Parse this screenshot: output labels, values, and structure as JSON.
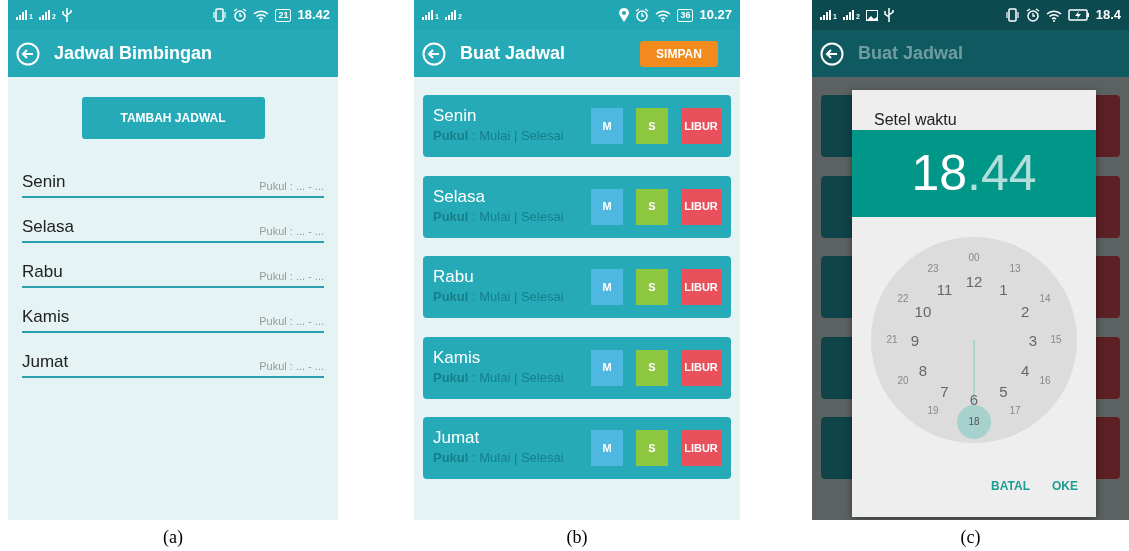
{
  "screens": [
    {
      "kind": "schedule_list",
      "caption": "(a)",
      "status_bar": {
        "sim_labels": [
          "1",
          "2"
        ],
        "battery": "21",
        "time": "18.42"
      },
      "app_bar": {
        "title": "Jadwal Bimbingan"
      },
      "add_button": "TAMBAH JADWAL",
      "days": [
        {
          "name": "Senin",
          "time": "Pukul : ... - ..."
        },
        {
          "name": "Selasa",
          "time": "Pukul : ... - ..."
        },
        {
          "name": "Rabu",
          "time": "Pukul : ... - ..."
        },
        {
          "name": "Kamis",
          "time": "Pukul : ... - ..."
        },
        {
          "name": "Jumat",
          "time": "Pukul : ... - ..."
        }
      ]
    },
    {
      "kind": "create_schedule",
      "caption": "(b)",
      "status_bar": {
        "sim_labels": [
          "1",
          "2"
        ],
        "battery": "36",
        "time": "10.27"
      },
      "app_bar": {
        "title": "Buat Jadwal",
        "action": "SIMPAN"
      },
      "days": [
        {
          "name": "Senin",
          "time": "**Pukul** : Mulai | Selesai",
          "buttons": [
            "M",
            "S",
            "LIBUR"
          ]
        },
        {
          "name": "Selasa",
          "time": "**Pukul** : Mulai | Selesai",
          "buttons": [
            "M",
            "S",
            "LIBUR"
          ]
        },
        {
          "name": "Rabu",
          "time": "**Pukul** : Mulai | Selesai",
          "buttons": [
            "M",
            "S",
            "LIBUR"
          ]
        },
        {
          "name": "Kamis",
          "time": "**Pukul** : Mulai | Selesai",
          "buttons": [
            "M",
            "S",
            "LIBUR"
          ]
        },
        {
          "name": "Jumat",
          "time": "**Pukul** : Mulai | Selesai",
          "buttons": [
            "M",
            "S",
            "LIBUR"
          ]
        }
      ]
    },
    {
      "kind": "time_picker",
      "caption": "(c)",
      "status_bar": {
        "sim_labels": [
          "1",
          "2"
        ],
        "time": "18.4"
      },
      "app_bar": {
        "title": "Buat Jadwal"
      },
      "dialog": {
        "title": "Setel waktu",
        "hour": {
          "text": "18",
          "selected": true
        },
        "separator": ".",
        "minute": {
          "text": "44",
          "selected": false
        },
        "inner_hours": [
          {
            "label": "12",
            "selected": false
          },
          {
            "label": "1",
            "selected": false
          },
          {
            "label": "2",
            "selected": false
          },
          {
            "label": "3",
            "selected": false
          },
          {
            "label": "4",
            "selected": false
          },
          {
            "label": "5",
            "selected": false
          },
          {
            "label": "6",
            "selected": false
          },
          {
            "label": "7",
            "selected": false
          },
          {
            "label": "8",
            "selected": false
          },
          {
            "label": "9",
            "selected": false
          },
          {
            "label": "10",
            "selected": false
          },
          {
            "label": "11",
            "selected": false
          }
        ],
        "outer_hours": [
          {
            "label": "00",
            "selected": false
          },
          {
            "label": "13",
            "selected": false
          },
          {
            "label": "14",
            "selected": false
          },
          {
            "label": "15",
            "selected": false
          },
          {
            "label": "16",
            "selected": false
          },
          {
            "label": "17",
            "selected": false
          },
          {
            "label": "18",
            "selected": true
          },
          {
            "label": "19",
            "selected": false
          },
          {
            "label": "20",
            "selected": false
          },
          {
            "label": "21",
            "selected": false
          },
          {
            "label": "22",
            "selected": false
          },
          {
            "label": "23",
            "selected": false
          }
        ],
        "buttons": [
          "BATAL",
          "OKE"
        ]
      }
    }
  ]
}
